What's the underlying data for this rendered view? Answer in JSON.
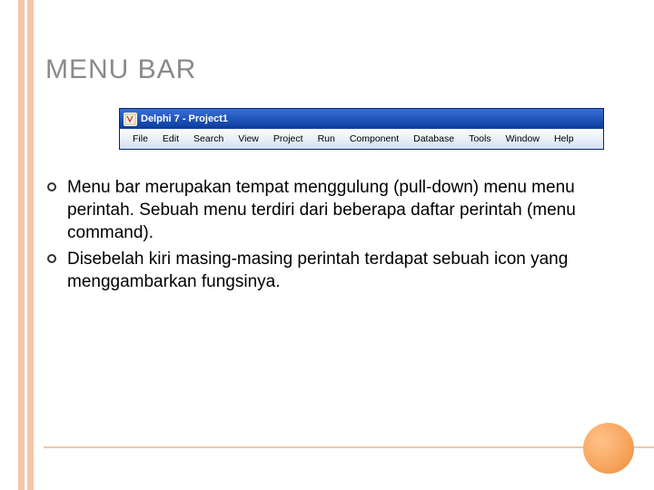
{
  "slide": {
    "title": "MENU BAR"
  },
  "window": {
    "title": "Delphi 7 - Project1",
    "menu": {
      "items": [
        {
          "label": "File"
        },
        {
          "label": "Edit"
        },
        {
          "label": "Search"
        },
        {
          "label": "View"
        },
        {
          "label": "Project"
        },
        {
          "label": "Run"
        },
        {
          "label": "Component"
        },
        {
          "label": "Database"
        },
        {
          "label": "Tools"
        },
        {
          "label": "Window"
        },
        {
          "label": "Help"
        }
      ]
    }
  },
  "bullets": [
    {
      "text": "Menu bar merupakan tempat menggulung (pull-down) menu menu perintah. Sebuah menu terdiri dari beberapa daftar perintah (menu command)."
    },
    {
      "text": "Disebelah kiri masing-masing perintah terdapat sebuah icon yang menggambarkan fungsinya."
    }
  ]
}
